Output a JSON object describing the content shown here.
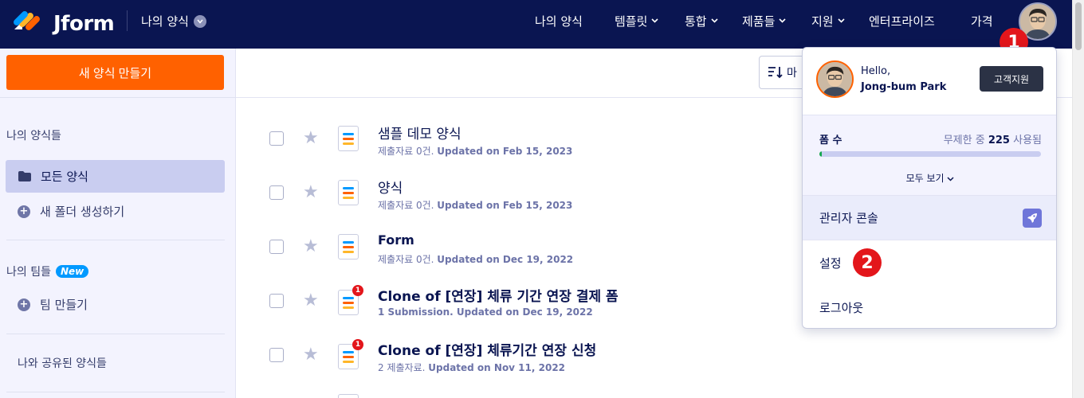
{
  "header": {
    "brand": "Jform",
    "my_forms_dropdown": "나의 양식",
    "nav": [
      {
        "label": "나의 양식",
        "has_chevron": false
      },
      {
        "label": "템플릿",
        "has_chevron": true
      },
      {
        "label": "통합",
        "has_chevron": true
      },
      {
        "label": "제품들",
        "has_chevron": true
      },
      {
        "label": "지원",
        "has_chevron": true
      },
      {
        "label": "엔터프라이즈",
        "has_chevron": false
      },
      {
        "label": "가격",
        "has_chevron": false
      }
    ],
    "callout_1": "1"
  },
  "sidebar": {
    "create_button": "새 양식 만들기",
    "my_forms_heading": "나의 양식들",
    "all_forms": "모든 양식",
    "new_folder": "새 폴더 생성하기",
    "my_teams_heading": "나의 팀들",
    "new_badge": "New",
    "create_team": "팀 만들기",
    "shared_forms": "나와 공유된 양식들"
  },
  "toolbar": {
    "sort_label": "마"
  },
  "forms": [
    {
      "title": "샘플 데모 양식",
      "sub_count": "제출자료 0건.",
      "sub_updated": "Updated on Feb 15, 2023",
      "badge": ""
    },
    {
      "title": "양식",
      "sub_count": "제출자료 0건.",
      "sub_updated": "Updated on Feb 15, 2023",
      "badge": ""
    },
    {
      "title": "Form",
      "sub_count": "제출자료 0건.",
      "sub_updated": "Updated on Dec 19, 2022",
      "badge": ""
    },
    {
      "title": "Clone of [연장] 체류 기간 연장 결제 폼",
      "sub_count": "1 Submission.",
      "sub_updated": "Updated on Dec 19, 2022",
      "badge": "1"
    },
    {
      "title": "Clone of [연장] 체류기간 연장 신청",
      "sub_count": "2 제출자료.",
      "sub_updated": "Updated on Nov 11, 2022",
      "badge": "1"
    }
  ],
  "account_menu": {
    "hello": "Hello,",
    "name": "Jong-bum Park",
    "support_button": "고객지원",
    "usage_label": "폼 수",
    "usage_prefix": "무제한 중",
    "usage_count": "225",
    "usage_suffix": "사용됨",
    "usage_fraction": 0.01,
    "view_all": "모두 보기",
    "admin_console": "관리자 콘솔",
    "settings": "설정",
    "logout": "로그아웃",
    "callout_2": "2"
  },
  "colors": {
    "navy": "#0a1551",
    "orange": "#ff6100",
    "callout_red": "#e3161b",
    "active_sidebar": "#c9cdf0",
    "new_badge": "#0099ff"
  }
}
